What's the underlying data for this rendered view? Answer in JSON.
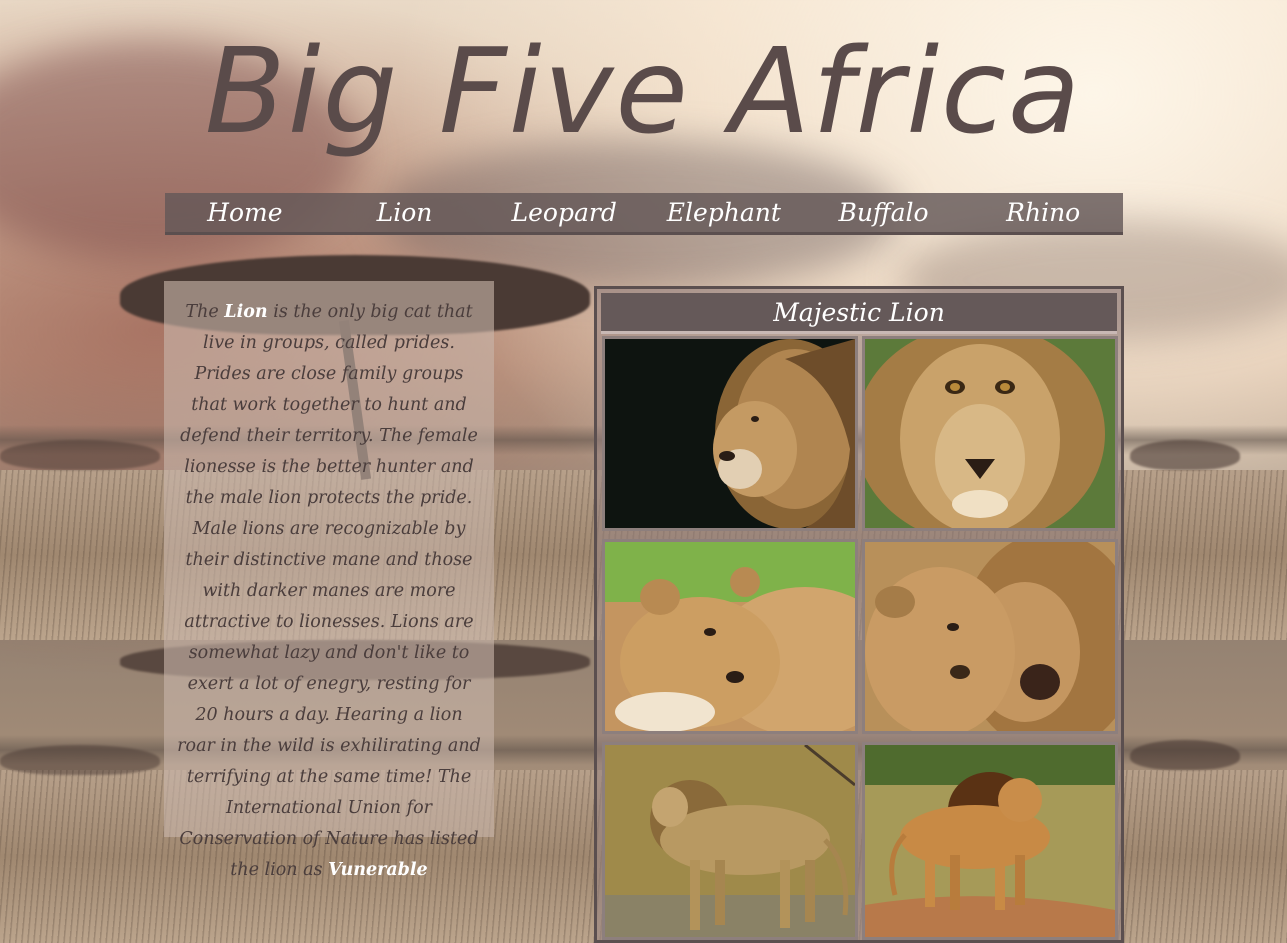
{
  "site": {
    "title": "Big Five Africa"
  },
  "nav": {
    "items": [
      {
        "label": "Home"
      },
      {
        "label": "Lion"
      },
      {
        "label": "Leopard"
      },
      {
        "label": "Elephant"
      },
      {
        "label": "Buffalo"
      },
      {
        "label": "Rhino"
      }
    ]
  },
  "description": {
    "intro": "The",
    "subject": "Lion",
    "body": "is the only big cat that live in groups, called prides. Prides are close family groups that work together to hunt and defend their territory. The female lionesse is the better hunter and the male lion protects the pride. Male lions are recognizable by their distinctive mane and those with darker manes are more attractive to lionesses. Lions are somewhat lazy and don't like to exert a lot of enegry, resting for 20 hours a day. Hearing a lion roar in the wild is exhilirating and terrifying at the same time! The International Union for Conservation of Nature has listed the lion as",
    "status": "Vunerable"
  },
  "gallery": {
    "title": "Majestic Lion",
    "photos": [
      {
        "subject": "male lion profile on dark background"
      },
      {
        "subject": "male lion face close-up"
      },
      {
        "subject": "lion cub resting on lioness"
      },
      {
        "subject": "lion cub nuzzling adult lion"
      },
      {
        "subject": "male lion walking in grass"
      },
      {
        "subject": "male lion walking on savanna track"
      }
    ]
  },
  "colors": {
    "title": "#5a4b4a",
    "nav_bg": "#655959",
    "nav_text": "#ffffff",
    "panel_text": "#4a3d3c"
  }
}
